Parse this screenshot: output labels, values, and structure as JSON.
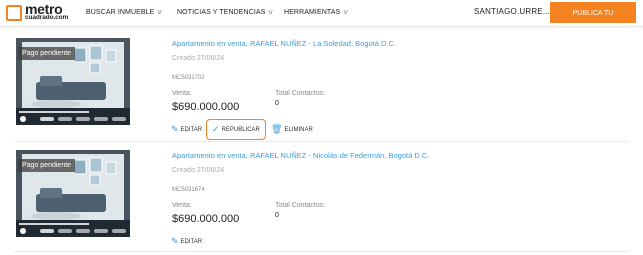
{
  "header": {
    "logo": {
      "brand": "metro",
      "sub": "cuadrado.com",
      "accent": "#f58220"
    },
    "nav": [
      {
        "label": "BUSCAR INMUEBLE",
        "icon": "chevron-down-icon"
      },
      {
        "label": "NOTICIAS Y TENDENCIAS",
        "icon": "chevron-down-icon"
      },
      {
        "label": "HERRAMIENTAS",
        "icon": "chevron-down-icon"
      }
    ],
    "user": "SANTIAGO.URRE...",
    "publish_label": "PUBLICA TU INMUEBLE"
  },
  "listings": [
    {
      "badge": "Pago pendiente",
      "title": "Apartamento en venta, RAFAEL NUÑEZ - La Soledad, Bogotá D.C.",
      "created": "Creado 27/06/24",
      "code": "MC5031702",
      "sale_label": "Venta:",
      "price": "$690.000.000",
      "contacts_label": "Total Contactos:",
      "contacts": "0",
      "actions": [
        "EDITAR",
        "REPUBLICAR",
        "ELIMINAR"
      ]
    },
    {
      "badge": "Pago pendiente",
      "title": "Apartamento en venta, RAFAEL NUÑEZ - Nicolás de Federmán, Bogotá D.C.",
      "created": "Creado 27/06/24",
      "code": "MC5031674",
      "sale_label": "Venta:",
      "price": "$690.000.000",
      "contacts_label": "Total Contactos:",
      "contacts": "0",
      "actions": [
        "EDITAR"
      ]
    }
  ],
  "colors": {
    "accent": "#f58220",
    "link": "#3aa0d8"
  }
}
